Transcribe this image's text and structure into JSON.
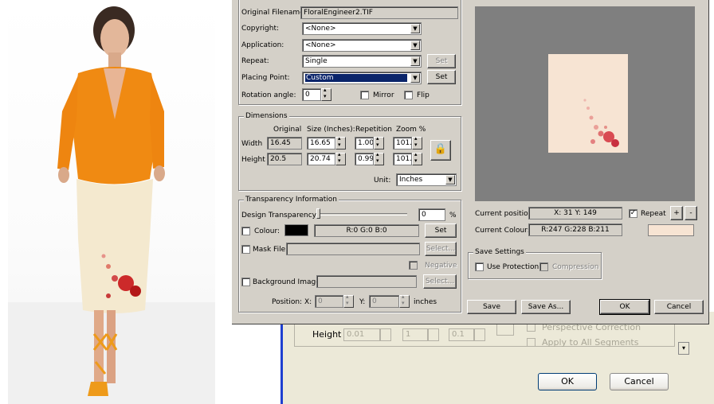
{
  "dialog": {
    "file_section": {
      "original_filename_label": "Original Filename:",
      "original_filename_value": "FloralEngineer2.TIF",
      "copyright_label": "Copyright:",
      "copyright_value": "<None>",
      "application_label": "Application:",
      "application_value": "<None>",
      "repeat_label": "Repeat:",
      "repeat_value": "Single",
      "repeat_set_button": "Set",
      "placing_point_label": "Placing Point:",
      "placing_point_value": "Custom",
      "placing_point_set_button": "Set",
      "rotation_label": "Rotation angle:",
      "rotation_value": "0",
      "mirror_label": "Mirror",
      "flip_label": "Flip"
    },
    "dimensions": {
      "title": "Dimensions",
      "col_original": "Original",
      "col_size": "Size (Inches):",
      "col_repetition": "Repetition",
      "col_zoom": "Zoom %",
      "width_label": "Width",
      "height_label": "Height",
      "width_original": "16.45",
      "width_size": "16.65",
      "width_repetition": "1.00",
      "width_zoom": "101.",
      "height_original": "20.5",
      "height_size": "20.74",
      "height_repetition": "0.99",
      "height_zoom": "101.",
      "unit_label": "Unit:",
      "unit_value": "Inches"
    },
    "transparency": {
      "title": "Transparency Information",
      "design_transparency_label": "Design Transparency:",
      "design_transparency_value": "0",
      "design_transparency_unit": "%",
      "slider_fraction": 0.0,
      "colour_label": "Colour:",
      "colour_swatch": "#000000",
      "colour_rgb": "R:0  G:0  B:0",
      "colour_set_button": "Set",
      "mask_file_label": "Mask File",
      "mask_select_button": "Select...",
      "negative_label": "Negative",
      "background_image_label": "Background Image",
      "bg_select_button": "Select...",
      "position_label": "Position:",
      "x_label": "X:",
      "x_value": "0",
      "y_label": "Y:",
      "y_value": "0",
      "position_unit": "inches"
    },
    "preview": {
      "current_position_label": "Current position:",
      "current_position_value": "X: 31   Y: 149",
      "repeat_label": "Repeat",
      "plus_button": "+",
      "minus_button": "-",
      "current_colour_label": "Current Colour:",
      "current_colour_value": "R:247  G:228  B:211",
      "current_colour_swatch": "#f7e4d3"
    },
    "save_settings": {
      "title": "Save Settings",
      "use_protection_label": "Use Protection",
      "compression_label": "Compression"
    },
    "buttons": {
      "save": "Save",
      "save_as": "Save As...",
      "ok": "OK",
      "cancel": "Cancel"
    }
  },
  "background_window": {
    "height_label": "Height",
    "height_value": "0.01",
    "field2_value": "1",
    "field3_value": "0.1",
    "perspective_label": "Perspective Correction",
    "apply_all_label": "Apply to All Segments",
    "ok_button": "OK",
    "cancel_button": "Cancel"
  }
}
